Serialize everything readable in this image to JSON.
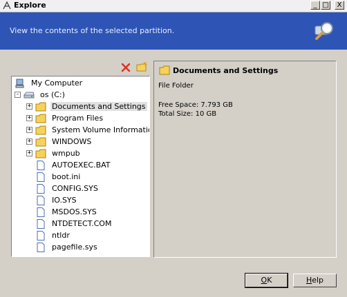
{
  "window": {
    "title": "Explore",
    "buttons": {
      "minimize": "_",
      "maximize": "□",
      "close": "X"
    }
  },
  "header": {
    "description": "View the contents of the selected partition."
  },
  "toolbar": {
    "delete_icon": "x-delete-icon",
    "new_folder_icon": "new-folder-icon"
  },
  "tree": {
    "items": [
      {
        "label": "My Computer",
        "icon": "computer-icon",
        "expander": ""
      },
      {
        "label": "os (C:)",
        "icon": "drive-icon",
        "expander": "-"
      },
      {
        "label": "Documents and Settings",
        "icon": "folder-icon",
        "expander": "+"
      },
      {
        "label": "Program Files",
        "icon": "folder-icon",
        "expander": "+"
      },
      {
        "label": "System Volume Information",
        "icon": "folder-icon",
        "expander": "+"
      },
      {
        "label": "WINDOWS",
        "icon": "folder-icon",
        "expander": "+"
      },
      {
        "label": "wmpub",
        "icon": "folder-icon",
        "expander": "+"
      },
      {
        "label": "AUTOEXEC.BAT",
        "icon": "file-icon",
        "expander": ""
      },
      {
        "label": "boot.ini",
        "icon": "file-icon",
        "expander": ""
      },
      {
        "label": "CONFIG.SYS",
        "icon": "file-icon",
        "expander": ""
      },
      {
        "label": "IO.SYS",
        "icon": "file-icon",
        "expander": ""
      },
      {
        "label": "MSDOS.SYS",
        "icon": "file-icon",
        "expander": ""
      },
      {
        "label": "NTDETECT.COM",
        "icon": "file-icon",
        "expander": ""
      },
      {
        "label": "ntldr",
        "icon": "file-icon",
        "expander": ""
      },
      {
        "label": "pagefile.sys",
        "icon": "file-icon",
        "expander": ""
      }
    ],
    "selected": "Documents and Settings"
  },
  "details": {
    "name": "Documents and Settings",
    "type": "File Folder",
    "free_space": "Free Space: 7.793 GB",
    "total_size": "Total Size: 10 GB"
  },
  "buttons": {
    "ok_label": "K",
    "ok_mnemonic": "O",
    "help_label": "elp",
    "help_mnemonic": "H"
  },
  "colors": {
    "header_bg": "#2e54b6",
    "folder": "#f5d25a",
    "delete_red": "#e0301e"
  }
}
